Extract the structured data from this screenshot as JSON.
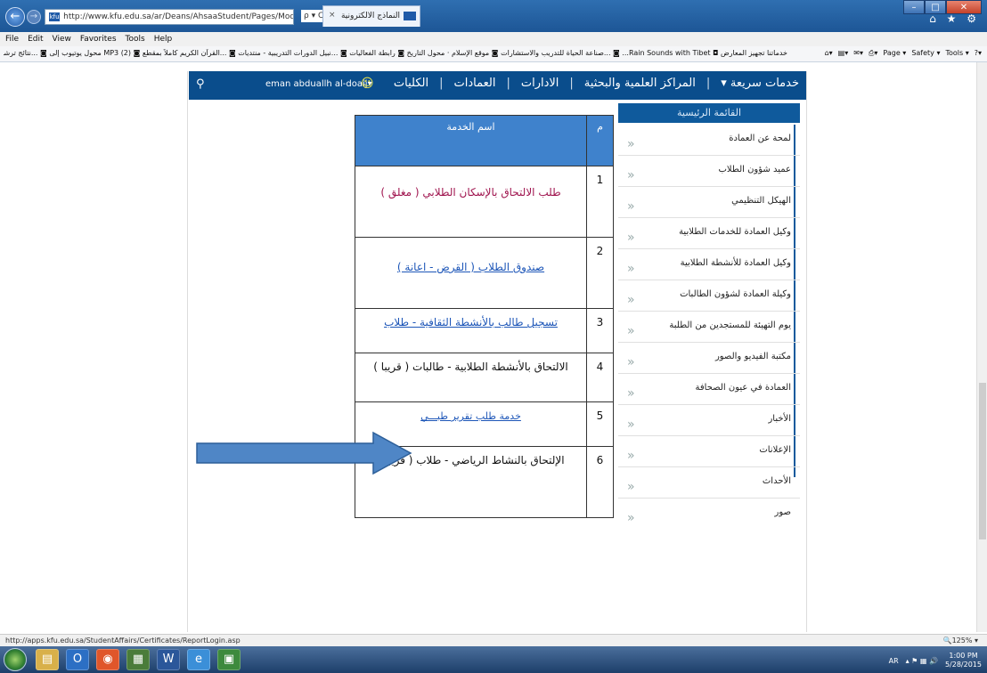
{
  "browser": {
    "url": "http://www.kfu.edu.sa/ar/Deans/AhsaaStudent/Pages/Models.aspx",
    "search_ctrl": "ρ ▾ C",
    "tab_title": "النماذج الالكترونية",
    "menu": [
      "File",
      "Edit",
      "View",
      "Favorites",
      "Tools",
      "Help"
    ],
    "favorites_text": "خدماتنا تجهيز المعارض ◘ Rain Sounds with Tibet... ◙ ...صناعة الحياة للتدريب والاستشارات ◙ موقع الإسلام · محول التاريخ ◙ رابطة الفعاليات ◙ ...نبيل الدورات التدريبية - منتديات ◙ ...القرآن الكريم كاملاً بمقطع ◙ MP3 (2) محول يوتيوب إلى ◙ ...نتائج ترشيح وقبول ◙ الصفحات",
    "cmd_items": [
      "Page ▾",
      "Safety ▾",
      "Tools ▾"
    ],
    "status_url": "http://apps.kfu.edu.sa/StudentAffairs/Certificates/ReportLogin.asp",
    "zoom": "125%"
  },
  "site_nav": {
    "items": [
      "الكليات",
      "العمادات",
      "الادارات",
      "المراكز العلمية والبحثية",
      "خدمات سريعة"
    ],
    "user": "eman abduallh al-doaij▾",
    "search_icon": "search-icon"
  },
  "main_menu": {
    "title": "القائمة الرئيسية",
    "items": [
      "لمحة عن العمادة",
      "عميد شؤون الطلاب",
      "الهيكل التنظيمي",
      "وكيل العمادة للخدمات الطلابية",
      "وكيل العمادة للأنشطة الطلابية",
      "وكيلة العمادة لشؤون الطالبات",
      "يوم التهيئة للمستجدين من الطلبة",
      "مكتبة الفيديو والصور",
      "العمادة في عيون الصحافة",
      "الأخبار",
      "الإعلانات",
      "الأحداث",
      "صور"
    ],
    "chevron": "«"
  },
  "services_table": {
    "col_num": "م",
    "col_name": "اسم الخدمة",
    "rows": [
      {
        "num": "1",
        "name": "طلب الالتحاق بالإسكان الطلابي ( مغلق )"
      },
      {
        "num": "2",
        "name": "صندوق الطلاب ( القرض - اعانة )"
      },
      {
        "num": "3",
        "name": "تسجيل طالب بالأنشطة الثقافية - طلاب"
      },
      {
        "num": "4",
        "name": "الالتحاق بالأنشطة الطلابية - طالبات ( قريبا )"
      },
      {
        "num": "5",
        "name": "خدمة طلب تقرير طبـــي"
      },
      {
        "num": "6",
        "name": "الإلتحاق بالنشاط الرياضي - طلاب ( قريباً )"
      }
    ]
  },
  "taskbar": {
    "lang": "AR",
    "time": "1:00 PM",
    "date": "5/28/2015"
  }
}
